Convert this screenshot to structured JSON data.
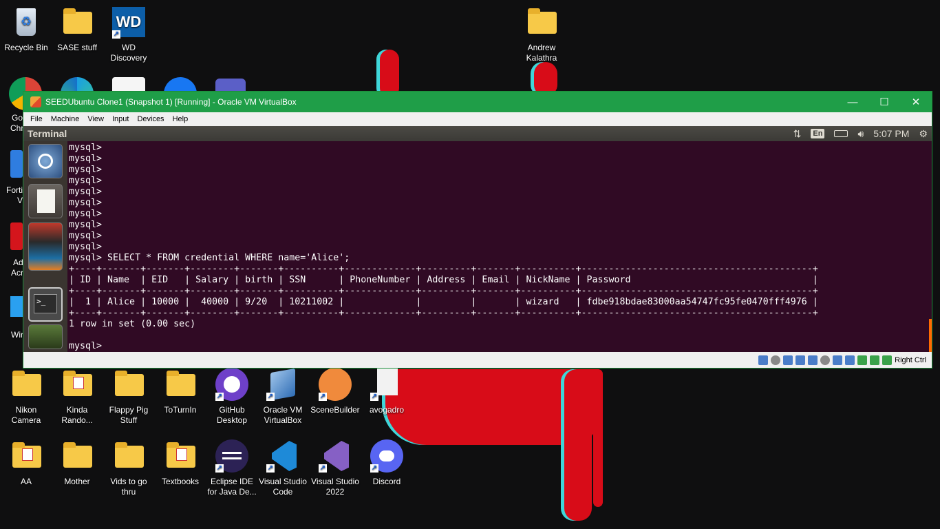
{
  "desktop": {
    "icons_top": [
      {
        "label": "Recycle Bin",
        "icon": "recycle-bin-icon"
      },
      {
        "label": "SASE stuff",
        "icon": "folder-icon"
      },
      {
        "label": "WD\nDiscovery",
        "icon": "wd-discovery-icon"
      },
      {
        "label": "Andrew\nKalathra",
        "icon": "folder-icon"
      }
    ],
    "icons_left_partial": [
      "Go",
      "Chr",
      "Forti",
      "V",
      "Ad",
      "Acr",
      "Wir"
    ],
    "icons_row1": [
      {
        "label": "Nikon\nCamera",
        "icon": "folder-icon"
      },
      {
        "label": "Kinda\nRando...",
        "icon": "folder-icon"
      },
      {
        "label": "Flappy Pig\nStuff",
        "icon": "folder-icon"
      },
      {
        "label": "ToTurnIn",
        "icon": "folder-icon"
      },
      {
        "label": "GitHub\nDesktop",
        "icon": "github-icon"
      },
      {
        "label": "Oracle VM\nVirtualBox",
        "icon": "virtualbox-icon"
      },
      {
        "label": "SceneBuilder",
        "icon": "scenebuilder-icon"
      },
      {
        "label": "avogadro",
        "icon": "file-icon"
      }
    ],
    "icons_row2": [
      {
        "label": "AA",
        "icon": "folder-icon"
      },
      {
        "label": "Mother",
        "icon": "folder-icon"
      },
      {
        "label": "Vids to go\nthru",
        "icon": "folder-icon"
      },
      {
        "label": "Textbooks",
        "icon": "folder-icon"
      },
      {
        "label": "Eclipse IDE\nfor Java De...",
        "icon": "eclipse-icon"
      },
      {
        "label": "Visual Studio\nCode",
        "icon": "vscode-icon"
      },
      {
        "label": "Visual Studio\n2022",
        "icon": "visual-studio-icon"
      },
      {
        "label": "Discord",
        "icon": "discord-icon"
      }
    ]
  },
  "vbox": {
    "title": "SEEDUbuntu Clone1 (Snapshot 1) [Running] - Oracle VM VirtualBox",
    "controls": {
      "minimize": "—",
      "maximize": "☐",
      "close": "✕"
    },
    "menu": [
      "File",
      "Machine",
      "View",
      "Input",
      "Devices",
      "Help"
    ],
    "status_host_key": "Right Ctrl",
    "accent": "#1f9e48"
  },
  "ubuntu_panel": {
    "title": "Terminal",
    "keyboard": "En",
    "time": "5:07 PM",
    "icons": [
      "network-arrows-icon",
      "battery-icon",
      "volume-icon",
      "settings-gear-icon"
    ]
  },
  "launcher": [
    "ubuntu-dash-icon",
    "text-editor-icon",
    "stacked-apps-icon",
    "firefox-icon",
    "terminal-icon",
    "wireshark-icon"
  ],
  "terminal": {
    "lines": [
      "mysql>",
      "mysql>",
      "mysql>",
      "mysql>",
      "mysql>",
      "mysql>",
      "mysql>",
      "mysql>",
      "mysql>",
      "mysql>",
      "mysql> SELECT * FROM credential WHERE name='Alice';",
      "+----+-------+-------+--------+-------+----------+-------------+---------+-------+----------+------------------------------------------+",
      "| ID | Name  | EID   | Salary | birth | SSN      | PhoneNumber | Address | Email | NickName | Password                                 |",
      "+----+-------+-------+--------+-------+----------+-------------+---------+-------+----------+------------------------------------------+",
      "|  1 | Alice | 10000 |  40000 | 9/20  | 10211002 |             |         |       | wizard   | fdbe918bdae83000aa54747fc95fe0470fff4976 |",
      "+----+-------+-------+--------+-------+----------+-------------+---------+-------+----------+------------------------------------------+",
      "1 row in set (0.00 sec)",
      "",
      "mysql> "
    ],
    "background": "#300a24"
  }
}
